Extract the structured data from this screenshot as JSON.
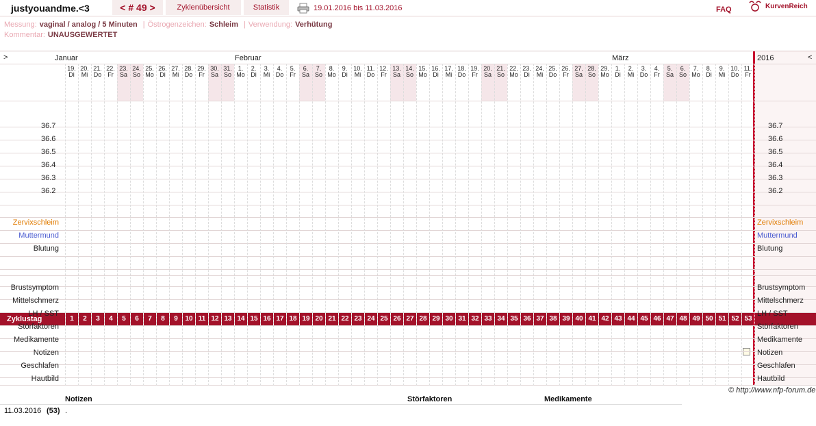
{
  "header": {
    "user": "justyouandme.<3",
    "cycle_nav": "< # 49 >",
    "tab_overview": "Zyklenübersicht",
    "tab_stats": "Statistik",
    "date_range": "19.01.2016 bis 11.03.2016",
    "faq": "FAQ",
    "brand": "KurvenReich"
  },
  "meta": {
    "messung_label": "Messung:",
    "messung_value": "vaginal / analog / 5 Minuten",
    "oestrogen_label": "Östrogenzeichen:",
    "oestrogen_value": "Schleim",
    "verwendung_label": "Verwendung:",
    "verwendung_value": "Verhütung",
    "kommentar_label": "Kommentar:",
    "kommentar_value": "UNAUSGEWERTET",
    "sep": "|"
  },
  "chart": {
    "nav_left": ">",
    "nav_right": "<",
    "year": "2016",
    "months": [
      "Januar",
      "Februar",
      "März"
    ],
    "days": [
      {
        "d": "19.",
        "w": "Di"
      },
      {
        "d": "20.",
        "w": "Mi"
      },
      {
        "d": "21.",
        "w": "Do"
      },
      {
        "d": "22.",
        "w": "Fr"
      },
      {
        "d": "23.",
        "w": "Sa"
      },
      {
        "d": "24.",
        "w": "So"
      },
      {
        "d": "25.",
        "w": "Mo"
      },
      {
        "d": "26.",
        "w": "Di"
      },
      {
        "d": "27.",
        "w": "Mi"
      },
      {
        "d": "28.",
        "w": "Do"
      },
      {
        "d": "29.",
        "w": "Fr"
      },
      {
        "d": "30.",
        "w": "Sa"
      },
      {
        "d": "31.",
        "w": "So"
      },
      {
        "d": "1.",
        "w": "Mo"
      },
      {
        "d": "2.",
        "w": "Di"
      },
      {
        "d": "3.",
        "w": "Mi"
      },
      {
        "d": "4.",
        "w": "Do"
      },
      {
        "d": "5.",
        "w": "Fr"
      },
      {
        "d": "6.",
        "w": "Sa"
      },
      {
        "d": "7.",
        "w": "So"
      },
      {
        "d": "8.",
        "w": "Mo"
      },
      {
        "d": "9.",
        "w": "Di"
      },
      {
        "d": "10.",
        "w": "Mi"
      },
      {
        "d": "11.",
        "w": "Do"
      },
      {
        "d": "12.",
        "w": "Fr"
      },
      {
        "d": "13.",
        "w": "Sa"
      },
      {
        "d": "14.",
        "w": "So"
      },
      {
        "d": "15.",
        "w": "Mo"
      },
      {
        "d": "16.",
        "w": "Di"
      },
      {
        "d": "17.",
        "w": "Mi"
      },
      {
        "d": "18.",
        "w": "Do"
      },
      {
        "d": "19.",
        "w": "Fr"
      },
      {
        "d": "20.",
        "w": "Sa"
      },
      {
        "d": "21.",
        "w": "So"
      },
      {
        "d": "22.",
        "w": "Mo"
      },
      {
        "d": "23.",
        "w": "Di"
      },
      {
        "d": "24.",
        "w": "Mi"
      },
      {
        "d": "25.",
        "w": "Do"
      },
      {
        "d": "26.",
        "w": "Fr"
      },
      {
        "d": "27.",
        "w": "Sa"
      },
      {
        "d": "28.",
        "w": "So"
      },
      {
        "d": "29.",
        "w": "Mo"
      },
      {
        "d": "1.",
        "w": "Di"
      },
      {
        "d": "2.",
        "w": "Mi"
      },
      {
        "d": "3.",
        "w": "Do"
      },
      {
        "d": "4.",
        "w": "Fr"
      },
      {
        "d": "5.",
        "w": "Sa"
      },
      {
        "d": "6.",
        "w": "So"
      },
      {
        "d": "7.",
        "w": "Mo"
      },
      {
        "d": "8.",
        "w": "Di"
      },
      {
        "d": "9.",
        "w": "Mi"
      },
      {
        "d": "10.",
        "w": "Do"
      },
      {
        "d": "11.",
        "w": "Fr"
      }
    ],
    "temps": [
      "36.7",
      "36.6",
      "36.5",
      "36.4",
      "36.3",
      "36.2"
    ],
    "row_zervix": "Zervixschleim",
    "row_muttermund": "Muttermund",
    "row_blutung": "Blutung",
    "row_zyklustag": "Zyklustag",
    "bottom_rows": [
      "Brustsymptom",
      "Mittelschmerz",
      "LH / SST",
      "Störfaktoren",
      "Medikamente",
      "Notizen",
      "Geschlafen",
      "Hautbild"
    ],
    "zervix_color": "#e07b00",
    "muttermund_color": "#4a5bd0",
    "accent": "#a3122a"
  },
  "footer": {
    "credit": "© http://www.nfp-forum.de",
    "col_notizen": "Notizen",
    "col_stoerfaktoren": "Störfaktoren",
    "col_medikamente": "Medikamente",
    "row_date": "11.03.2016",
    "row_day": "(53)",
    "row_note": "."
  }
}
